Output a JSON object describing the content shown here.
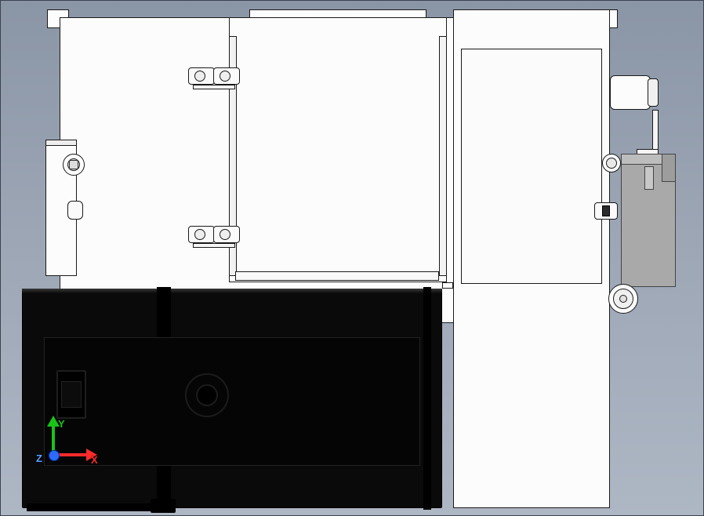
{
  "triad": {
    "x_label": "X",
    "y_label": "Y",
    "z_label": "Z"
  },
  "axis_colors": {
    "x": "#ff2b2b",
    "y": "#19c319",
    "z": "#2b6cff"
  }
}
